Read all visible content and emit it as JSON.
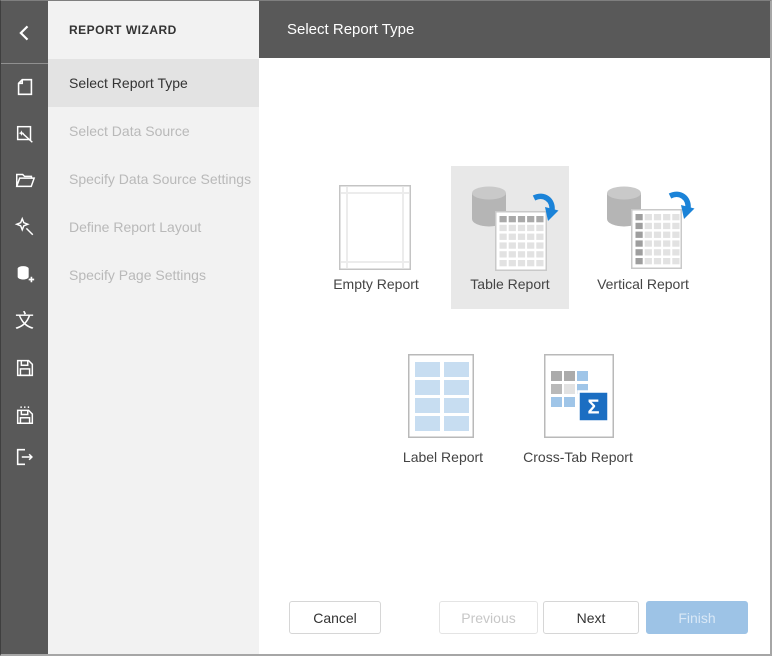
{
  "sidebar": {
    "icons": [
      "back",
      "new-report",
      "report-wizard",
      "open-report",
      "design-in-wizard",
      "add-data-source",
      "localization",
      "save",
      "save-as",
      "exit"
    ],
    "localization_glyph": "文"
  },
  "wizard": {
    "title": "REPORT WIZARD",
    "steps": [
      {
        "label": "Select Report Type",
        "state": "active"
      },
      {
        "label": "Select Data Source",
        "state": "disabled"
      },
      {
        "label": "Specify Data Source Settings",
        "state": "disabled"
      },
      {
        "label": "Define Report Layout",
        "state": "disabled"
      },
      {
        "label": "Specify Page Settings",
        "state": "disabled"
      }
    ]
  },
  "main": {
    "header": "Select Report Type",
    "report_types": [
      {
        "label": "Empty Report",
        "selected": false
      },
      {
        "label": "Table Report",
        "selected": true
      },
      {
        "label": "Vertical Report",
        "selected": false
      },
      {
        "label": "Label Report",
        "selected": false
      },
      {
        "label": "Cross-Tab Report",
        "selected": false
      }
    ],
    "sigma_glyph": "Σ",
    "buttons": [
      {
        "label": "Cancel",
        "state": "enabled"
      },
      {
        "label": "Previous",
        "state": "disabled"
      },
      {
        "label": "Next",
        "state": "enabled"
      },
      {
        "label": "Finish",
        "state": "disabled-primary"
      }
    ]
  },
  "colors": {
    "sidebar_bg": "#595959",
    "header_bg": "#595959",
    "panel_bg": "#f2f2f2",
    "active_step_bg": "#e3e3e3",
    "selected_tile_bg": "#e8e8e8",
    "arrow_blue": "#1b83d8",
    "sigma_blue": "#1b6ec2",
    "label_cell_blue": "#c7ddf1",
    "finish_button_bg": "#9dc3e6"
  }
}
